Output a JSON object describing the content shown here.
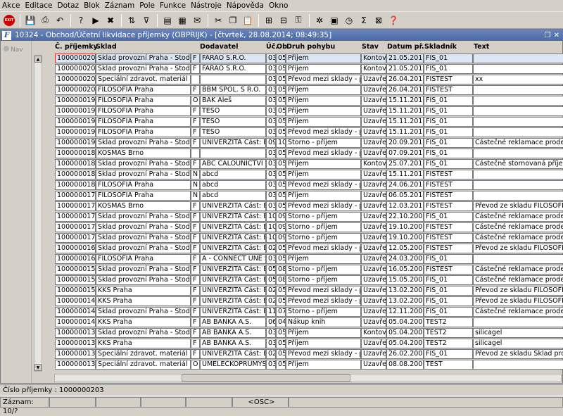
{
  "menu": [
    "Akce",
    "Editace",
    "Dotaz",
    "Blok",
    "Záznam",
    "Pole",
    "Funkce",
    "Nástroje",
    "Nápověda",
    "Okno"
  ],
  "toolbar": {
    "exit_label": "EXIT",
    "icons": [
      "save-icon",
      "print-icon",
      "undo-icon",
      "query-icon",
      "execute-query-icon",
      "cancel-query-icon",
      "sort-icon",
      "filter-icon",
      "report-icon",
      "preview-icon",
      "mail-icon",
      "cut-icon",
      "copy-icon",
      "paste-icon",
      "insert-record-icon",
      "delete-record-icon",
      "lock-icon",
      "settings-icon",
      "calculator-icon",
      "clock-icon",
      "sum-icon",
      "excel-icon",
      "help-icon"
    ]
  },
  "window": {
    "title": "10324 - Obchod/Účetní likvidace příjemky (OBPRIJK) - [čtvrtek, 28.08.2014; 08:49:35]",
    "app_icon": "F",
    "nav_label": "Nav"
  },
  "table": {
    "headers": {
      "id": "Č. příjemky",
      "sklad": "Sklad",
      "dodavatel": "Dodavatel",
      "uc": "Úč.",
      "ob": "Ob",
      "druh": "Druh pohybu",
      "stav": "Stav",
      "datum": "Datum př.",
      "skladnik": "Skladník",
      "text": "Text"
    },
    "rows": [
      {
        "id": "1000000203",
        "sklad": "Sklad provozní Praha - Stodůlky",
        "f": "F",
        "dod": "FARAO S.R.O.",
        "uc": "03",
        "ob": "05",
        "druh": "Příjem",
        "stav": "Kontová",
        "datum": "21.05.2013",
        "skl": "FIS_01",
        "text": ""
      },
      {
        "id": "1000000202",
        "sklad": "Sklad provozní Praha - Stodůlky",
        "f": "F",
        "dod": "FARAO S.R.O.",
        "uc": "03",
        "ob": "05",
        "druh": "Příjem",
        "stav": "Kontová",
        "datum": "21.05.2013",
        "skl": "FIS_01",
        "text": ""
      },
      {
        "id": "1000000201",
        "sklad": "Speciální zdravot. materiál Kladno",
        "f": "",
        "dod": "",
        "uc": "03",
        "ob": "05",
        "druh": "Převod mezi sklady - příjem",
        "stav": "Uzavřen",
        "datum": "26.04.2013",
        "skl": "FISTEST",
        "text": "xx"
      },
      {
        "id": "1000000200",
        "sklad": "FILOSOFIA Praha",
        "f": "F",
        "dod": "BBM SPOL. S R.O.",
        "uc": "03",
        "ob": "05",
        "druh": "Příjem",
        "stav": "Uzavřen",
        "datum": "26.04.2013",
        "skl": "FISTEST",
        "text": ""
      },
      {
        "id": "1000000199",
        "sklad": "FILOSOFIA Praha",
        "f": "O",
        "dod": "BAK Aleš",
        "uc": "03",
        "ob": "05",
        "druh": "Příjem",
        "stav": "Uzavřen",
        "datum": "15.11.2012",
        "skl": "FIS_01",
        "text": ""
      },
      {
        "id": "1000000198",
        "sklad": "FILOSOFIA Praha",
        "f": "F",
        "dod": "TESO",
        "uc": "03",
        "ob": "05",
        "druh": "Příjem",
        "stav": "Uzavřen",
        "datum": "15.11.2012",
        "skl": "FIS_01",
        "text": ""
      },
      {
        "id": "1000000197",
        "sklad": "FILOSOFIA Praha",
        "f": "F",
        "dod": "TESO",
        "uc": "03",
        "ob": "05",
        "druh": "Příjem",
        "stav": "Uzavřen",
        "datum": "15.11.2012",
        "skl": "FIS_01",
        "text": ""
      },
      {
        "id": "1000000196",
        "sklad": "FILOSOFIA Praha",
        "f": "F",
        "dod": "TESO",
        "uc": "03",
        "ob": "05",
        "druh": "Převod mezi sklady - příjem",
        "stav": "Uzavřen",
        "datum": "15.11.2012",
        "skl": "FIS_01",
        "text": ""
      },
      {
        "id": "1000000191",
        "sklad": "Sklad provozní Praha - Stodůlky",
        "f": "F",
        "dod": "UNIVERZITA Část: EkF",
        "uc": "09",
        "ob": "10",
        "druh": "Storno - příjem",
        "stav": "Uzavřen",
        "datum": "20.09.2010",
        "skl": "FIS_01",
        "text": "Částečné reklamace prodejky č.:"
      },
      {
        "id": "1000000185",
        "sklad": "KOSMAS Brno",
        "f": "",
        "dod": "",
        "uc": "03",
        "ob": "05",
        "druh": "Převod mezi sklady - příjem",
        "stav": "Uzavřen",
        "datum": "07.09.2010",
        "skl": "FIS_01",
        "text": ""
      },
      {
        "id": "1000000182",
        "sklad": "Sklad provozní Praha - Stodůlky",
        "f": "F",
        "dod": "ABC CALOUNICTVI pro",
        "uc": "03",
        "ob": "05",
        "druh": "Příjem",
        "stav": "Kontová",
        "datum": "25.07.2010",
        "skl": "FIS_01",
        "text": " Částečně stornovaná příjemka v"
      },
      {
        "id": "1000000181",
        "sklad": "Sklad provozní Praha - Stodůlky",
        "f": "N",
        "dod": "abcd",
        "uc": "03",
        "ob": "05",
        "druh": "Příjem",
        "stav": "Uzavřen",
        "datum": "15.11.2012",
        "skl": "FISTEST",
        "text": ""
      },
      {
        "id": "1000000180",
        "sklad": "FILOSOFIA Praha",
        "f": "N",
        "dod": "abcd",
        "uc": "03",
        "ob": "05",
        "druh": "Převod mezi sklady - příjem",
        "stav": "Uzavřen",
        "datum": "24.06.2010",
        "skl": "FISTEST",
        "text": ""
      },
      {
        "id": "1000000178",
        "sklad": "FILOSOFIA Praha",
        "f": "N",
        "dod": "abcd",
        "uc": "03",
        "ob": "05",
        "druh": "Příjem",
        "stav": "Uzavřen",
        "datum": "06.05.2014",
        "skl": "FISTEST",
        "text": ""
      },
      {
        "id": "1000000177",
        "sklad": "KOSMAS Brno",
        "f": "F",
        "dod": "UNIVERZITA Část: EkF",
        "uc": "03",
        "ob": "05",
        "druh": "Převod mezi sklady - příjem",
        "stav": "Uzavřen",
        "datum": "12.03.2010",
        "skl": "FISTEST",
        "text": "Převod ze skladu FILOSOFIA Pra"
      },
      {
        "id": "1000000176",
        "sklad": "Sklad provozní Praha - Stodůlky",
        "f": "F",
        "dod": "UNIVERZITA Část: EkF",
        "uc": "10",
        "ob": "09",
        "druh": "Storno - příjem",
        "stav": "Uzavřen",
        "datum": "22.10.2009",
        "skl": "FIS_01",
        "text": "Částečné reklamace prodejky č.:"
      },
      {
        "id": "1000000175",
        "sklad": "Sklad provozní Praha - Stodůlky",
        "f": "F",
        "dod": "UNIVERZITA Část: EkF",
        "uc": "10",
        "ob": "09",
        "druh": "Storno - příjem",
        "stav": "Uzavřen",
        "datum": "19.10.2009",
        "skl": "FISTEST",
        "text": "Částečné reklamace prodejky č.:"
      },
      {
        "id": "1000000174",
        "sklad": "Sklad provozní Praha - Stodůlky",
        "f": "F",
        "dod": "UNIVERZITA Část: EkF",
        "uc": "10",
        "ob": "09",
        "druh": "Storno - příjem",
        "stav": "Uzavřen",
        "datum": "19.10.2009",
        "skl": "FISTEST",
        "text": "Částečné reklamace prodejky č.:"
      },
      {
        "id": "1000000169",
        "sklad": "Sklad provozní Praha - Stodůlky",
        "f": "F",
        "dod": "UNIVERZITA Část: EkF",
        "uc": "02",
        "ob": "05",
        "druh": "Převod mezi sklady - příjem",
        "stav": "Uzavřen",
        "datum": "12.05.2009",
        "skl": "FISTEST",
        "text": "Převod ze skladu FILOSOFIA Pra"
      },
      {
        "id": "1000000165",
        "sklad": "FILOSOFIA Praha",
        "f": "F",
        "dod": "A - CONNECT UNE SPO",
        "uc": "03",
        "ob": "05",
        "druh": "Příjem",
        "stav": "Uzavřen",
        "datum": "24.03.2009",
        "skl": "FIS_01",
        "text": ""
      },
      {
        "id": "1000000154",
        "sklad": "Sklad provozní Praha - Stodůlky",
        "f": "F",
        "dod": "UNIVERZITA Část: EkF",
        "uc": "05",
        "ob": "08",
        "druh": "Storno - příjem",
        "stav": "Uzavřen",
        "datum": "16.05.2008",
        "skl": "FISTEST",
        "text": "Částečné reklamace prodejky č.:"
      },
      {
        "id": "1000000153",
        "sklad": "Sklad provozní Praha - Stodůlky",
        "f": "F",
        "dod": "UNIVERZITA Část: EkF",
        "uc": "05",
        "ob": "08",
        "druh": "Storno - příjem",
        "stav": "Uzavřen",
        "datum": "15.05.2008",
        "skl": "FIS_01",
        "text": "Částečné reklamace prodejky č.:"
      },
      {
        "id": "1000000151",
        "sklad": "KKS Praha",
        "f": "F",
        "dod": "UNIVERZITA Část: EkF",
        "uc": "02",
        "ob": "05",
        "druh": "Převod mezi sklady - příjem",
        "stav": "Uzavřen",
        "datum": "13.02.2008",
        "skl": "FIS_01",
        "text": "Převod ze skladu FILOSOFIA Pra"
      },
      {
        "id": "1000000149",
        "sklad": "KKS Praha",
        "f": "F",
        "dod": "UNIVERZITA Část: EkF",
        "uc": "02",
        "ob": "05",
        "druh": "Převod mezi sklady - příjem",
        "stav": "Uzavřen",
        "datum": "13.02.2008",
        "skl": "FIS_01",
        "text": "Převod ze skladu FILOSOFIA Pra"
      },
      {
        "id": "1000000148",
        "sklad": "Sklad provozní Praha - Stodůlky",
        "f": "F",
        "dod": "UNIVERZITA Část: EkF",
        "uc": "11",
        "ob": "07",
        "druh": "Storno - příjem",
        "stav": "Uzavřen",
        "datum": "12.11.2007",
        "skl": "FIS_01",
        "text": "Částečné reklamace prodejky č.:"
      },
      {
        "id": "1000000140",
        "sklad": "KKS Praha",
        "f": "F",
        "dod": "AB BANKA A.S.",
        "uc": "06",
        "ob": "04",
        "druh": "Nákup knih",
        "stav": "Uzavřen",
        "datum": "05.04.2007",
        "skl": "TEST2",
        "text": ""
      },
      {
        "id": "1000000139",
        "sklad": "Sklad provozní Praha - Stodůlky",
        "f": "F",
        "dod": "AB BANKA A.S.",
        "uc": "03",
        "ob": "05",
        "druh": "Příjem",
        "stav": "Kontová",
        "datum": "05.04.2007",
        "skl": "TEST2",
        "text": "silicagel"
      },
      {
        "id": "1000000138",
        "sklad": "KKS Praha",
        "f": "F",
        "dod": "AB BANKA A.S.",
        "uc": "03",
        "ob": "05",
        "druh": "Příjem",
        "stav": "Uzavřen",
        "datum": "05.04.2007",
        "skl": "TEST2",
        "text": "silicagel"
      },
      {
        "id": "1000000134",
        "sklad": "Speciální zdravot. materiál Kladno",
        "f": "F",
        "dod": "UNIVERZITA Část: EkF",
        "uc": "02",
        "ob": "05",
        "druh": "Převod mezi sklady - příjem",
        "stav": "Uzavřen",
        "datum": "26.02.2007",
        "skl": "FIS_01",
        "text": "Převod ze skladu Sklad provozní"
      },
      {
        "id": "1000000131",
        "sklad": "Speciální zdravot. materiál Kladno",
        "f": "O",
        "dod": "UMELECKOPRUMYSLO",
        "uc": "03",
        "ob": "05",
        "druh": "Příjem",
        "stav": "Uzavřen",
        "datum": "08.08.2006",
        "skl": "TEST",
        "text": ""
      }
    ]
  },
  "status": {
    "message": "Číslo příjemky : 1000000203",
    "record": "Záznam: 10/?",
    "osc": "<OSC>"
  }
}
